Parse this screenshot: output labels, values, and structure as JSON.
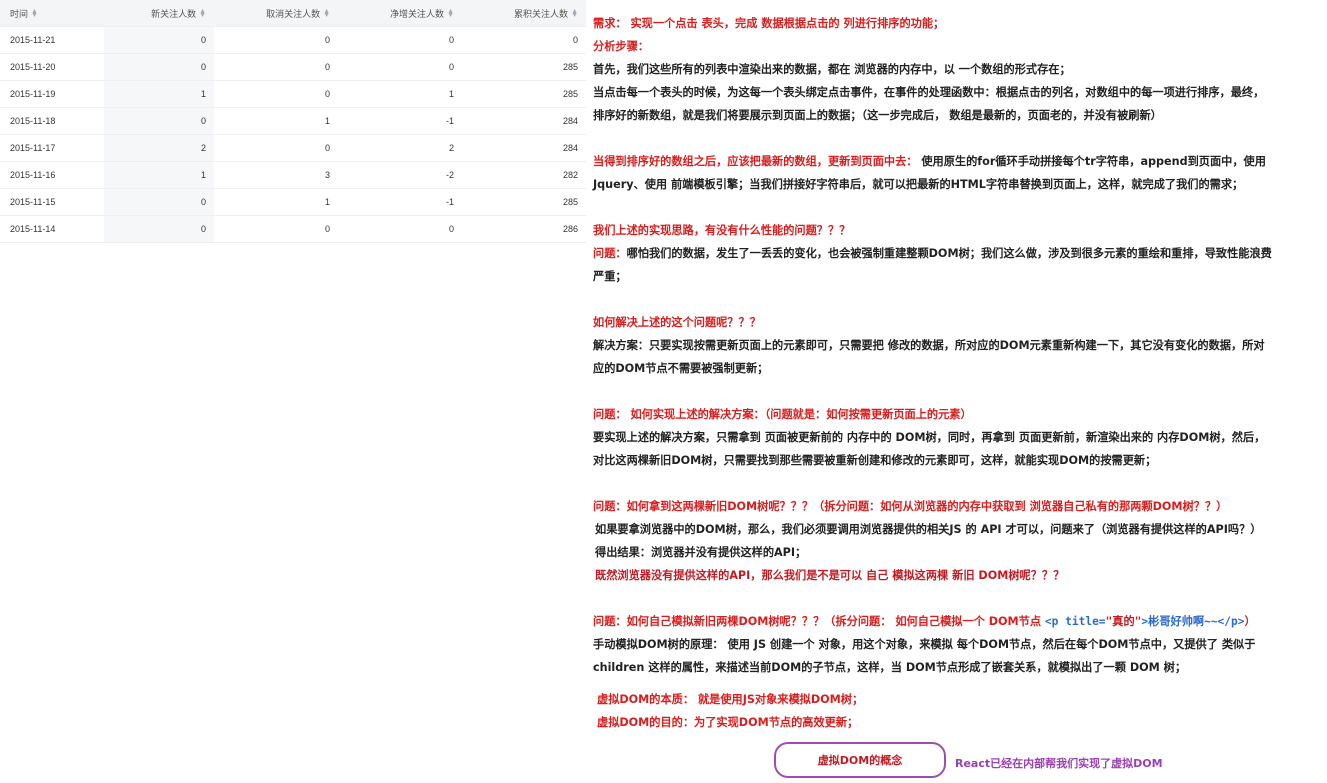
{
  "table": {
    "headers": [
      "时间",
      "新关注人数",
      "取消关注人数",
      "净增关注人数",
      "累积关注人数"
    ],
    "rows": [
      [
        "2015-11-21",
        "0",
        "0",
        "0",
        "0"
      ],
      [
        "2015-11-20",
        "0",
        "0",
        "0",
        "285"
      ],
      [
        "2015-11-19",
        "1",
        "0",
        "1",
        "285"
      ],
      [
        "2015-11-18",
        "0",
        "1",
        "-1",
        "284"
      ],
      [
        "2015-11-17",
        "2",
        "0",
        "2",
        "284"
      ],
      [
        "2015-11-16",
        "1",
        "3",
        "-2",
        "282"
      ],
      [
        "2015-11-15",
        "0",
        "1",
        "-1",
        "285"
      ],
      [
        "2015-11-14",
        "0",
        "0",
        "0",
        "286"
      ]
    ]
  },
  "notes": {
    "req": "需求： 实现一个点击 表头，完成 数据根据点击的 列进行排序的功能；",
    "steps_title": "分析步骤：",
    "s1": "首先，我们这些所有的列表中渲染出来的数据，都在 浏览器的内存中，以 一个数组的形式存在；",
    "s2a": "当点击每一个表头的时候，为这每一个表头绑定点击事件，在事件的处理函数中：根据点击的列名，对数组中的每一项进行排序，最终，",
    "s2b": "排序好的新数组，就是我们将要展示到页面上的数据；（这一步完成后， 数组是最新的，页面老的，并没有被刷新）",
    "s3a_red": "当得到排序好的数组之后，应该把最新的数组，更新到页面中去：",
    "s3a_black": " 使用原生的for循环手动拼接每个tr字符串，append到页面中，使用",
    "s3b": "Jquery、使用 前端模板引擎；当我们拼接好字符串后，就可以把最新的HTML字符串替换到页面上，这样，就完成了我们的需求；",
    "q1": "我们上述的实现思路，有没有什么性能的问题？？？",
    "p1a_red": "问题：",
    "p1a_black": "哪怕我们的数据，发生了一丢丢的变化，也会被强制重建整颗DOM树；我们这么做，涉及到很多元素的重绘和重排，导致性能浪费",
    "p1b": "严重；",
    "q2": "如何解决上述的这个问题呢？？？",
    "sol1": "解决方案：只要实现按需更新页面上的元素即可，只需要把 修改的数据，所对应的DOM元素重新构建一下，其它没有变化的数据，所对",
    "sol2": "应的DOM节点不需要被强制更新；",
    "q3": "问题： 如何实现上述的解决方案：（问题就是：如何按需更新页面上的元素）",
    "a3a": "要实现上述的解决方案，只需拿到 页面被更新前的 内存中的 DOM树，同时，再拿到 页面更新前，新渲染出来的 内存DOM树，然后，",
    "a3b": "对比这两棵新旧DOM树，只需要找到那些需要被重新创建和修改的元素即可，这样，就能实现DOM的按需更新；",
    "q4": "问题：如何拿到这两棵新旧DOM树呢？？？（拆分问题：如何从浏览器的内存中获取到 浏览器自己私有的那两颗DOM树？？）",
    "a4a": "如果要拿浏览器中的DOM树，那么，我们必须要调用浏览器提供的相关JS 的 API 才可以，问题来了（浏览器有提供这样的API吗？）",
    "a4b": "得出结果：浏览器并没有提供这样的API；",
    "a4c": "既然浏览器没有提供这样的API，那么我们是不是可以 自己 模拟这两棵 新旧 DOM树呢？？？",
    "q5": "问题：如何自己模拟新旧两棵DOM树呢？？？（拆分问题： 如何自己模拟一个 DOM节点 ",
    "q5_code_open": "<p title=",
    "q5_code_str": "\"真的\"",
    "q5_code_rest": ">彬哥好帅啊~~</p>",
    "q5_end": "）",
    "a5a": "手动模拟DOM树的原理： 使用 JS 创建一个 对象，用这个对象，来模拟 每个DOM节点，然后在每个DOM节点中，又提供了 类似于",
    "a5b": "children 这样的属性，来描述当前DOM的子节点，这样，当 DOM节点形成了嵌套关系，就模拟出了一颗 DOM 树；",
    "ess": "虚拟DOM的本质： 就是使用JS对象来模拟DOM树；",
    "goal": "虚拟DOM的目的：为了实现DOM节点的高效更新；"
  },
  "concept": {
    "label": "虚拟DOM的概念",
    "note": "React已经在内部帮我们实现了虚拟DOM"
  },
  "colors": {
    "red": "#d81e1e",
    "purple": "#9b4fb5",
    "code_blue": "#2d6bcc"
  }
}
